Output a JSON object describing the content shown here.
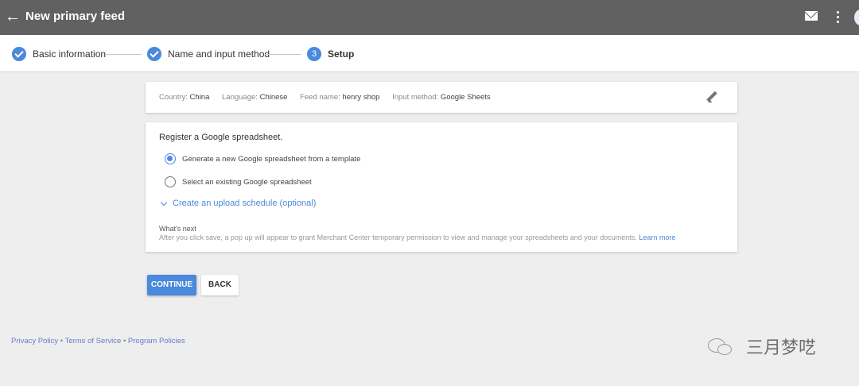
{
  "header": {
    "title": "New primary feed",
    "back_icon": "arrow-back-icon",
    "mail_icon": "mail-icon",
    "more_icon": "more-vert-icon"
  },
  "stepper": {
    "steps": [
      {
        "label": "Basic information",
        "state": "done"
      },
      {
        "label": "Name and input method",
        "state": "done"
      },
      {
        "label": "Setup",
        "state": "active",
        "number": "3"
      }
    ]
  },
  "summary": {
    "items": [
      {
        "key": "Country:",
        "value": "China"
      },
      {
        "key": "Language:",
        "value": "Chinese"
      },
      {
        "key": "Feed name:",
        "value": "henry shop"
      },
      {
        "key": "Input method:",
        "value": "Google Sheets"
      }
    ],
    "edit_icon": "edit-pencil-icon"
  },
  "main": {
    "title": "Register a Google spreadsheet.",
    "options": [
      {
        "label": "Generate a new Google spreadsheet from a template",
        "checked": true
      },
      {
        "label": "Select an existing Google spreadsheet",
        "checked": false
      }
    ],
    "schedule_link": "Create an upload schedule (optional)",
    "whats_next_title": "What's next",
    "whats_next_text": "After you click save, a pop up will appear to grant Merchant Center temporary permission to view and manage your spreadsheets and your documents.",
    "learn_more": "Learn more"
  },
  "buttons": {
    "continue": "CONTINUE",
    "back": "BACK"
  },
  "footer": {
    "privacy": "Privacy Policy",
    "terms": "Terms of Service",
    "program": "Program Policies",
    "separator": "•"
  },
  "watermark": {
    "text": "三月梦呓",
    "icon": "wechat-icon"
  },
  "colors": {
    "topbar": "#616161",
    "accent": "#4a89dc",
    "background": "#eeeeee"
  }
}
